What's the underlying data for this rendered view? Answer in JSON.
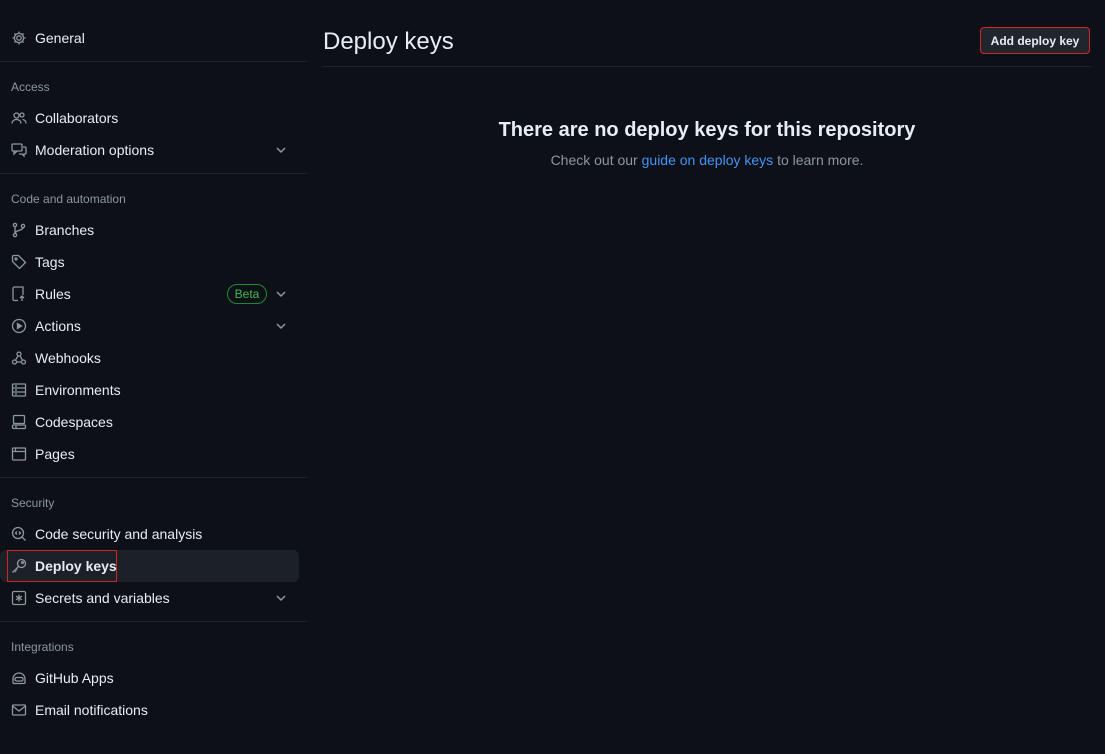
{
  "sidebar": {
    "general": "General",
    "access_title": "Access",
    "collaborators": "Collaborators",
    "moderation": "Moderation options",
    "code_title": "Code and automation",
    "branches": "Branches",
    "tags": "Tags",
    "rules": "Rules",
    "rules_badge": "Beta",
    "actions": "Actions",
    "webhooks": "Webhooks",
    "environments": "Environments",
    "codespaces": "Codespaces",
    "pages": "Pages",
    "security_title": "Security",
    "code_security": "Code security and analysis",
    "deploy_keys": "Deploy keys",
    "secrets": "Secrets and variables",
    "integrations_title": "Integrations",
    "github_apps": "GitHub Apps",
    "email_notifications": "Email notifications"
  },
  "main": {
    "title": "Deploy keys",
    "add_button": "Add deploy key",
    "blank_title": "There are no deploy keys for this repository",
    "blank_prefix": "Check out our",
    "blank_link": "guide on deploy keys",
    "blank_suffix": "to learn more."
  },
  "colors": {
    "background": "#0d1117",
    "accent_link": "#4493f8",
    "beta_green": "#3fb950",
    "highlight_red": "#d1242f"
  }
}
